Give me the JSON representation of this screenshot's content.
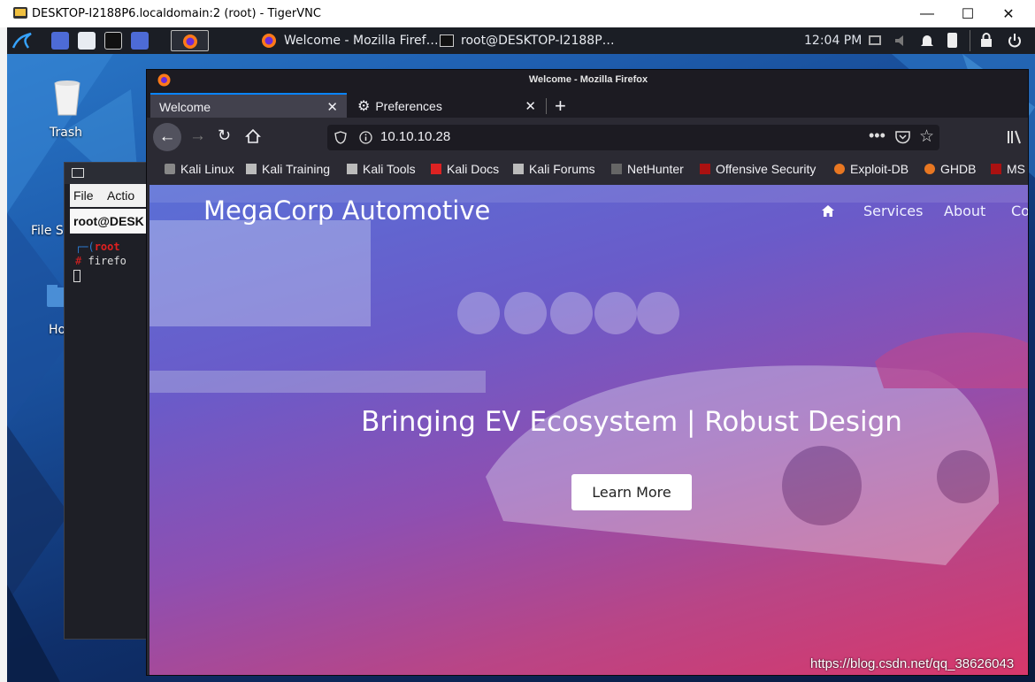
{
  "vnc": {
    "title": "DESKTOP-I2188P6.localdomain:2 (root) - TigerVNC",
    "minimize": "—",
    "maximize": "☐",
    "close": "✕"
  },
  "panel": {
    "tasks": [
      "Welcome - Mozilla Firef…",
      "root@DESKTOP-I2188P…"
    ],
    "clock": "12:04 PM"
  },
  "desktop": {
    "icons": [
      "Trash",
      "File S",
      "Ho"
    ]
  },
  "terminal": {
    "menu": [
      "File",
      "Actio"
    ],
    "title": "root@DESK",
    "prompt_user": "root",
    "command": "firefo"
  },
  "firefox": {
    "window_title": "Welcome - Mozilla Firefox",
    "tabs": [
      {
        "label": "Welcome",
        "active": true
      },
      {
        "label": "Preferences",
        "active": false
      }
    ],
    "new_tab": "+",
    "url": "10.10.10.28",
    "bookmarks": [
      "Kali Linux",
      "Kali Training",
      "Kali Tools",
      "Kali Docs",
      "Kali Forums",
      "NetHunter",
      "Offensive Security",
      "Exploit-DB",
      "GHDB",
      "MS"
    ]
  },
  "page": {
    "brand": "MegaCorp Automotive",
    "nav": [
      "Services",
      "About",
      "Co"
    ],
    "hero_title": "Bringing EV Ecosystem | Robust Design",
    "cta": "Learn More"
  },
  "watermark": "https://blog.csdn.net/qq_38626043",
  "colors": {
    "panel": "#1b1e25",
    "firefox_chrome": "#2b2a33",
    "tab_accent": "#0a84ff",
    "hero_from": "#5a6fd6",
    "hero_to": "#d8376a"
  }
}
